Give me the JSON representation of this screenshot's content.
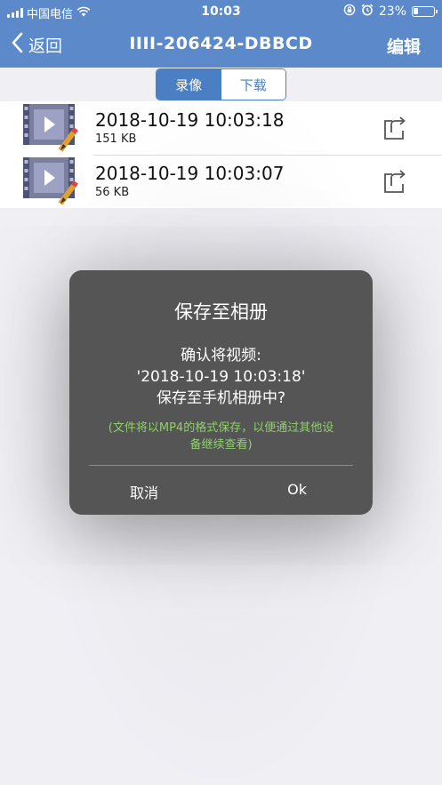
{
  "status_bar": {
    "carrier": "中国电信",
    "time": "10:03",
    "battery_text": "23%",
    "battery_level": 0.23,
    "icons": [
      "signal-icon",
      "wifi-icon",
      "orientation-lock-icon",
      "alarm-icon",
      "battery-icon"
    ]
  },
  "nav": {
    "back_label": "返回",
    "title": "IIII-206424-DBBCD",
    "edit_label": "编辑"
  },
  "segment": {
    "tabs": [
      {
        "label": "录像",
        "active": true
      },
      {
        "label": "下载",
        "active": false
      }
    ]
  },
  "recordings": [
    {
      "title": "2018-10-19  10:03:18",
      "size": "151 KB"
    },
    {
      "title": "2018-10-19  10:03:07",
      "size": "56 KB"
    }
  ],
  "dialog": {
    "title": "保存至相册",
    "message_lines": [
      "确认将视频:",
      "'2018-10-19  10:03:18'",
      "保存至手机相册中?"
    ],
    "note_lines": [
      "(文件将以MP4的格式保存，以便通过其他设",
      "备继续查看)"
    ],
    "cancel_label": "取消",
    "ok_label": "Ok"
  },
  "colors": {
    "nav_blue": "#5b89c9",
    "segment_blue": "#4a7fc4",
    "dialog_bg": "#555555",
    "note_green": "#8fd06a",
    "page_bg": "#efeff4"
  }
}
